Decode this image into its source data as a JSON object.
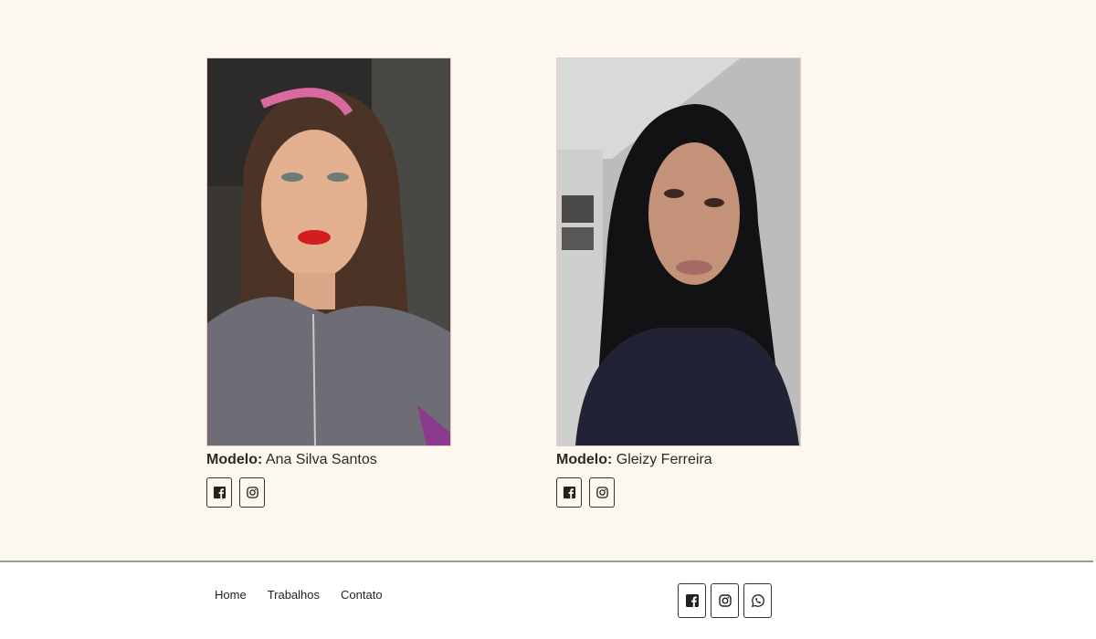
{
  "models": [
    {
      "caption_label": "Modelo:",
      "name": "Ana Silva Santos",
      "photo_alt": "Ana Silva Santos",
      "socials": [
        "facebook-icon",
        "instagram-icon"
      ]
    },
    {
      "caption_label": "Modelo:",
      "name": "Gleizy Ferreira",
      "photo_alt": "Gleizy Ferreira",
      "socials": [
        "facebook-icon",
        "instagram-icon"
      ]
    }
  ],
  "footer": {
    "nav": [
      "Home",
      "Trabalhos",
      "Contato"
    ],
    "socials": [
      "facebook-icon",
      "instagram-icon",
      "whatsapp-icon"
    ]
  },
  "colors": {
    "background": "#fdf8ee",
    "footer_background": "#ffffff",
    "photo_border": "#e8c9cf",
    "text": "#222222"
  }
}
